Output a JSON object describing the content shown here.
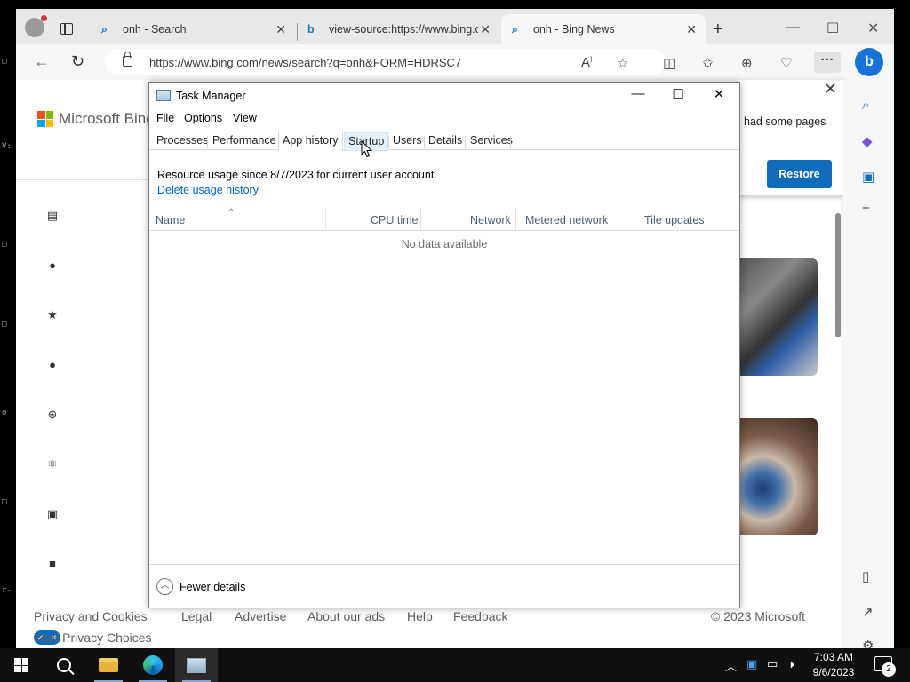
{
  "browser": {
    "tabs": [
      {
        "label": "onh - Search"
      },
      {
        "label": "view-source:https://www.bing.c"
      },
      {
        "label": "onh - Bing News"
      }
    ],
    "url": "https://www.bing.com/news/search?q=onh&FORM=HDRSC7",
    "brand": "Microsoft Bing",
    "restore_popup": {
      "message": "had some pages",
      "button": "Restore"
    },
    "footer": {
      "links": [
        "Privacy and Cookies",
        "Legal",
        "Advertise",
        "About our ads",
        "Help",
        "Feedback"
      ],
      "copyright": "© 2023 Microsoft",
      "privacy_choices": "Your Privacy Choices"
    }
  },
  "task_manager": {
    "title": "Task Manager",
    "menu": [
      "File",
      "Options",
      "View"
    ],
    "tabs": [
      "Processes",
      "Performance",
      "App history",
      "Startup",
      "Users",
      "Details",
      "Services"
    ],
    "active_tab": "App history",
    "hovered_tab": "Startup",
    "info": "Resource usage since 8/7/2023 for current user account.",
    "delete_link": "Delete usage history",
    "columns": [
      "Name",
      "CPU time",
      "Network",
      "Metered network",
      "Tile updates"
    ],
    "empty_message": "No data available",
    "fewer_details": "Fewer details"
  },
  "taskbar": {
    "time": "7:03 AM",
    "date": "9/6/2023",
    "notification_count": "2"
  },
  "colors": {
    "accent": "#0f6cbd",
    "link": "#0066cc"
  }
}
